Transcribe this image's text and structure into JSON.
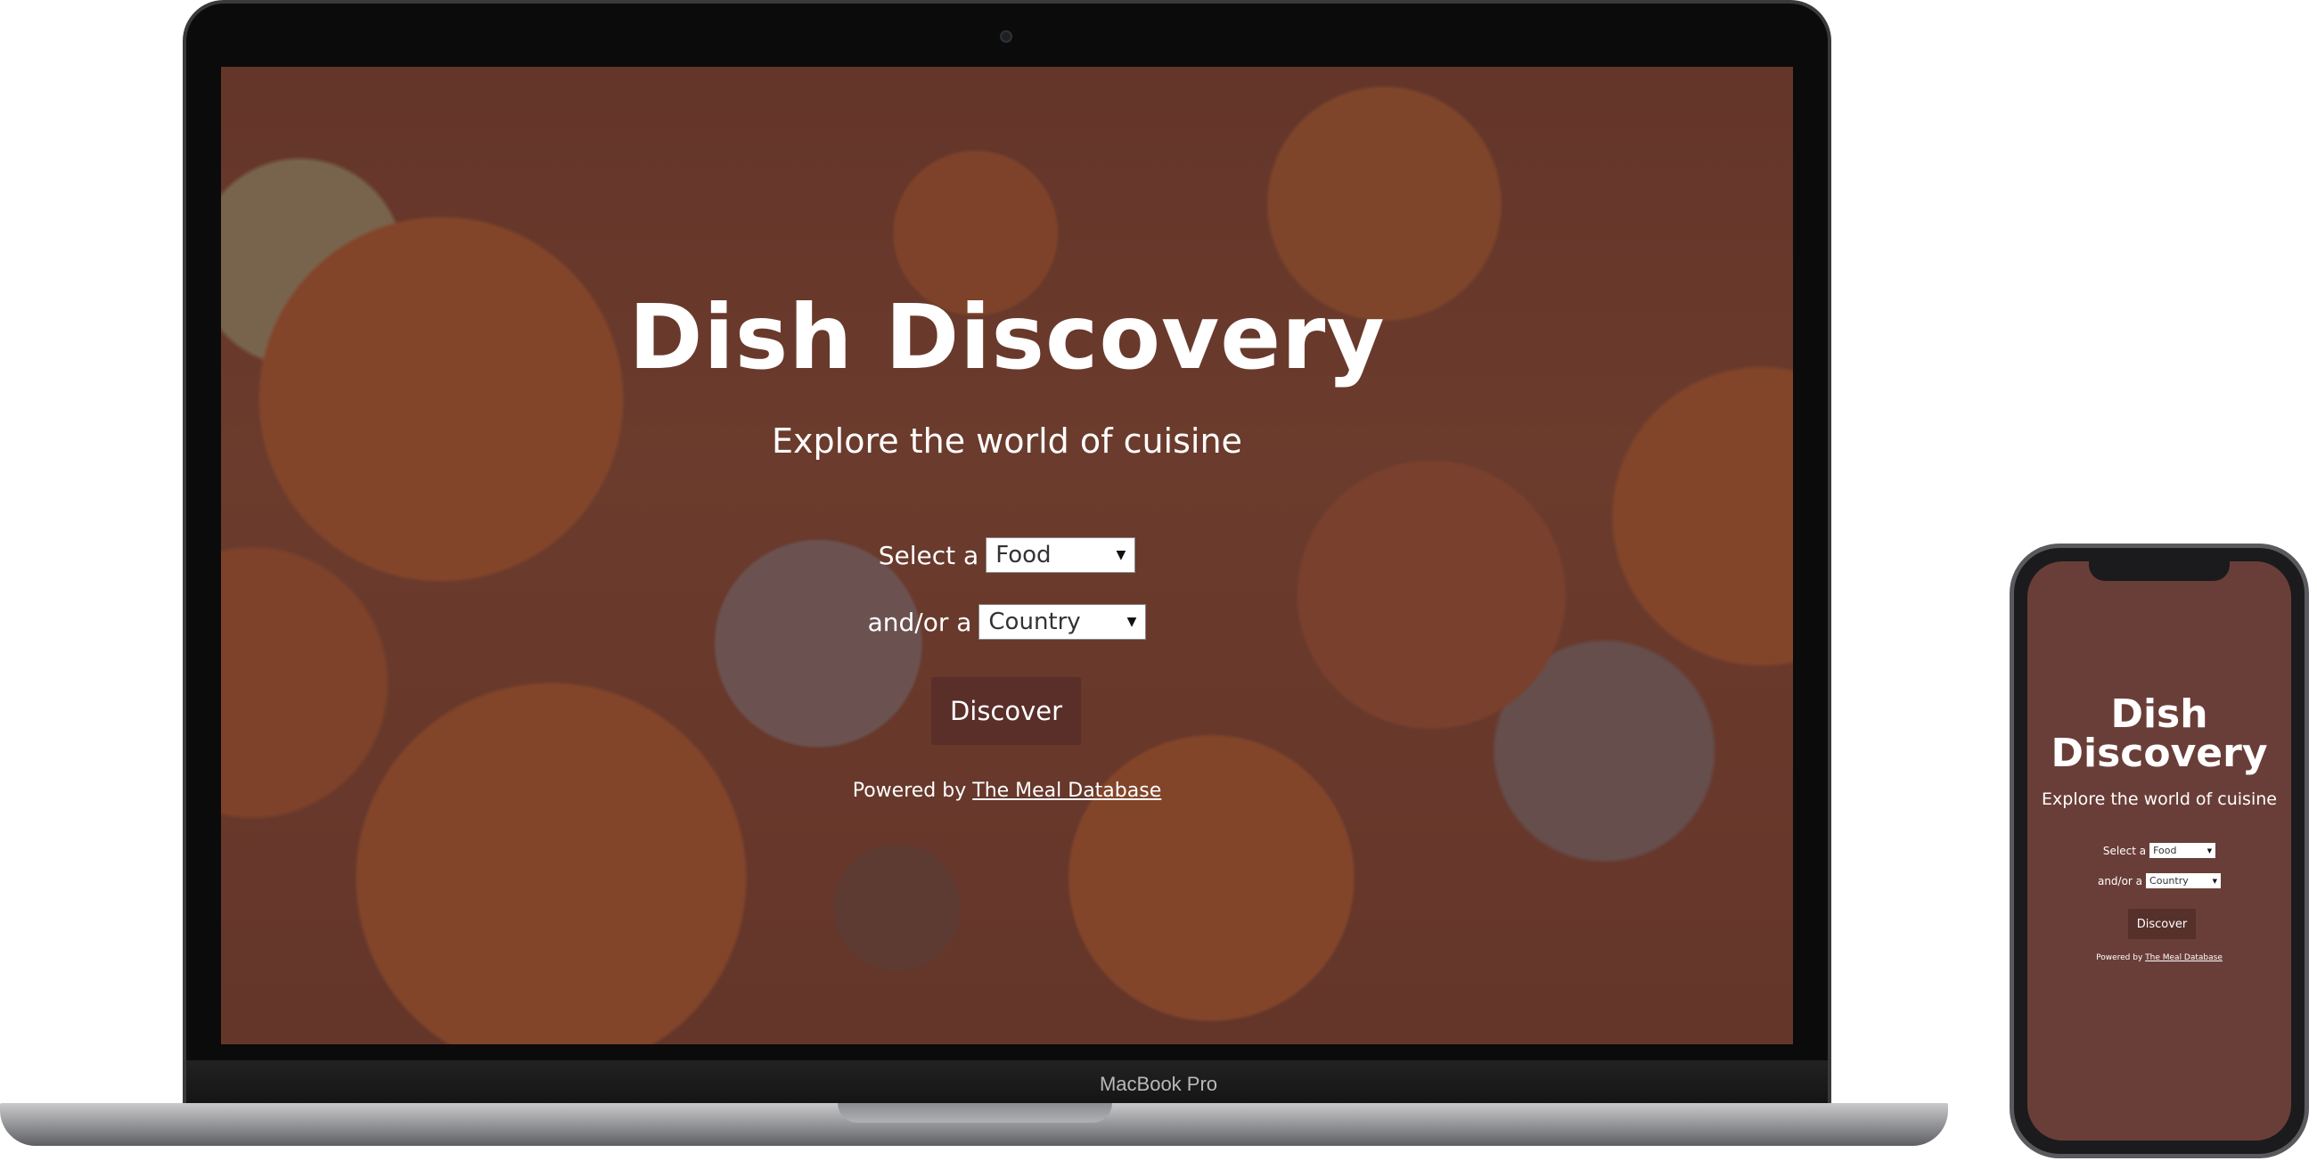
{
  "app": {
    "title": "Dish Discovery",
    "subtitle": "Explore the world of cuisine"
  },
  "form": {
    "select_label": "Select a",
    "select_value": "Food",
    "andor_label": "and/or a",
    "country_value": "Country",
    "discover_label": "Discover"
  },
  "footer": {
    "powered_prefix": "Powered by",
    "link_text": "The Meal Database"
  },
  "device": {
    "laptop_label": "MacBook Pro"
  },
  "phone": {
    "title_line1": "Dish",
    "title_line2": "Discovery",
    "subtitle": "Explore the world of cuisine",
    "select_label": "Select a",
    "select_value": "Food",
    "andor_label": "and/or a",
    "country_value": "Country",
    "discover_label": "Discover",
    "powered_prefix": "Powered by",
    "link_text": "The Meal Database"
  },
  "colors": {
    "overlay": "#5f3028",
    "button": "#5a2e29",
    "phone_bg": "#6a3e38"
  }
}
